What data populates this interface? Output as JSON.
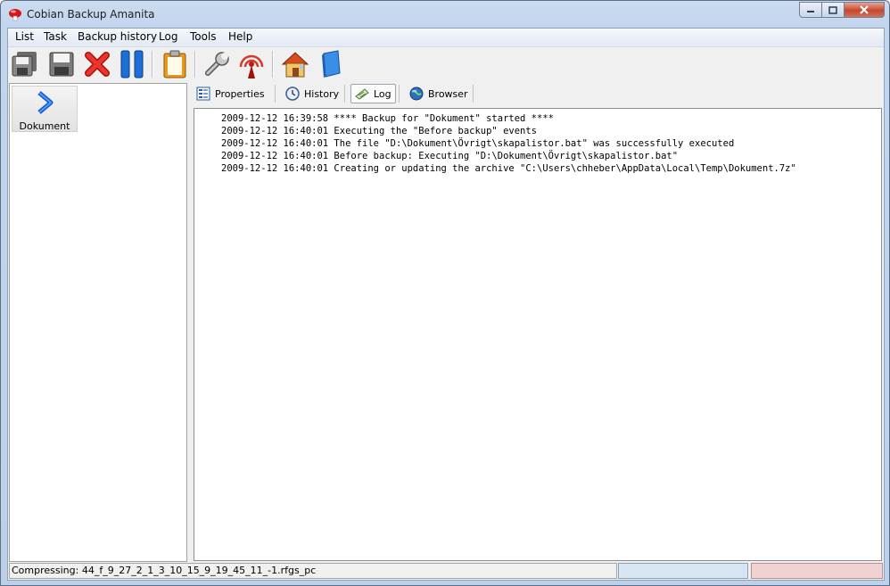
{
  "window": {
    "title": "Cobian Backup Amanita"
  },
  "menu": [
    {
      "label": "List"
    },
    {
      "label": "Task"
    },
    {
      "label": "Backup history"
    },
    {
      "label": "Log"
    },
    {
      "label": "Tools"
    },
    {
      "label": "Help"
    }
  ],
  "toolbar": {
    "buttons": [
      {
        "name": "run-all-icon"
      },
      {
        "name": "save-icon"
      },
      {
        "name": "delete-icon"
      },
      {
        "name": "pause-icon"
      },
      {
        "name": "clipboard-icon"
      },
      {
        "name": "wrench-icon"
      },
      {
        "name": "antenna-icon"
      },
      {
        "name": "home-icon"
      },
      {
        "name": "book-icon"
      }
    ]
  },
  "tasks": [
    {
      "label": "Dokument",
      "icon": "chevron-right-icon"
    }
  ],
  "tabs": [
    {
      "label": "Properties",
      "icon": "properties-icon"
    },
    {
      "label": "History",
      "icon": "clock-icon"
    },
    {
      "label": "Log",
      "icon": "log-icon",
      "active": true
    },
    {
      "label": "Browser",
      "icon": "globe-icon"
    }
  ],
  "log": {
    "lines": [
      "2009-12-12 16:39:58 **** Backup for \"Dokument\" started ****",
      "2009-12-12 16:40:01 Executing the \"Before backup\" events",
      "2009-12-12 16:40:01 The file \"D:\\Dokument\\Övrigt\\skapalistor.bat\" was successfully executed",
      "2009-12-12 16:40:01 Before backup: Executing \"D:\\Dokument\\Övrigt\\skapalistor.bat\"",
      "2009-12-12 16:40:01 Creating or updating the archive \"C:\\Users\\chheber\\AppData\\Local\\Temp\\Dokument.7z\""
    ]
  },
  "status": {
    "text": "Compressing: 44_f_9_27_2_1_3_10_15_9_19_45_11_-1.rfgs_pc"
  },
  "colors": {
    "status_blue": "#d8e6f4",
    "status_red": "#f0d2d2",
    "accent": "#1b63d6"
  }
}
